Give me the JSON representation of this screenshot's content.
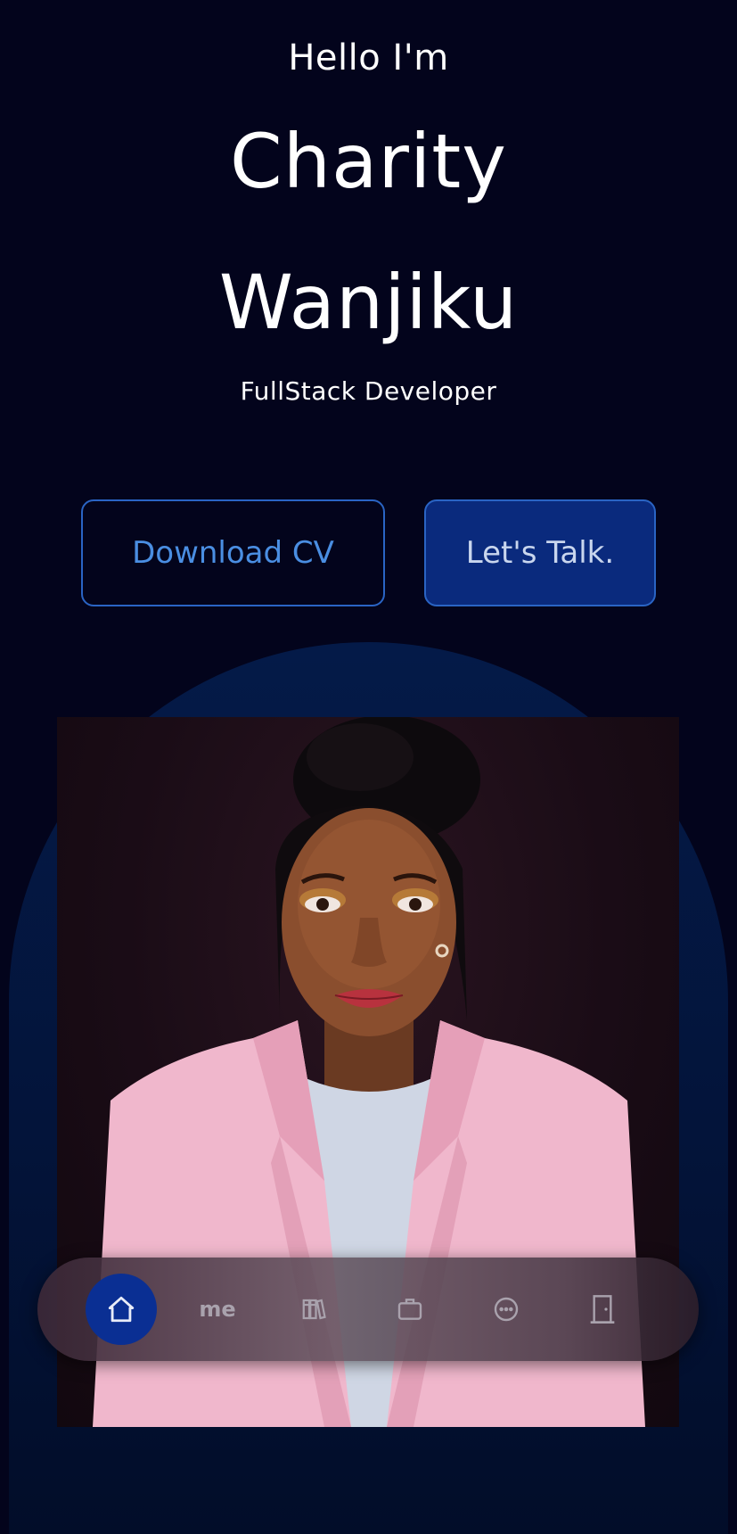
{
  "hero": {
    "greeting": "Hello I'm",
    "first_name": "Charity",
    "last_name": "Wanjiku",
    "role": "FullStack Developer"
  },
  "actions": {
    "download_label": "Download CV",
    "talk_label": "Let's Talk."
  },
  "nav": {
    "items": [
      {
        "icon": "home-icon",
        "active": true
      },
      {
        "label": "me",
        "active": false
      },
      {
        "icon": "books-icon",
        "active": false
      },
      {
        "icon": "briefcase-icon",
        "active": false
      },
      {
        "icon": "chat-bubble-icon",
        "active": false
      },
      {
        "icon": "door-icon",
        "active": false
      }
    ]
  },
  "colors": {
    "background": "#03041c",
    "accent": "#2a64c4",
    "button_fill": "#0a2a7d",
    "active_nav": "#0a2f93",
    "jacket": "#f0b7cc"
  }
}
